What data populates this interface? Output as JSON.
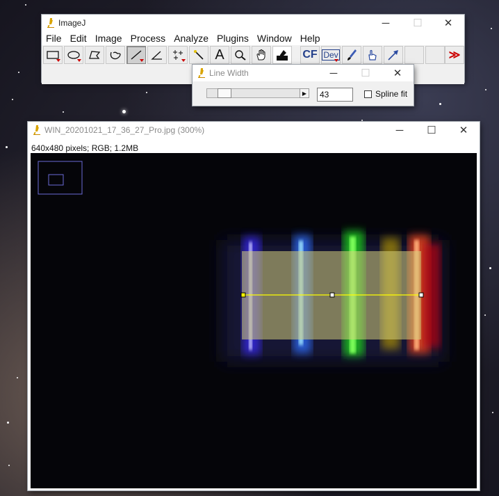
{
  "imagej": {
    "title": "ImageJ",
    "menus": [
      "File",
      "Edit",
      "Image",
      "Process",
      "Analyze",
      "Plugins",
      "Window",
      "Help"
    ],
    "tools_text": {
      "cf": "CF",
      "dev": "Dev",
      "more": "≫",
      "text": "A"
    }
  },
  "line_width": {
    "title": "Line Width",
    "value": "43",
    "spline_label": "Spline fit",
    "spline_checked": false
  },
  "image_window": {
    "title": "WIN_20201021_17_36_27_Pro.jpg (300%)",
    "info": "640x480 pixels; RGB; 1.2MB"
  },
  "window_controls": {
    "minimize": "─",
    "maximize": "☐",
    "close": "✕"
  }
}
